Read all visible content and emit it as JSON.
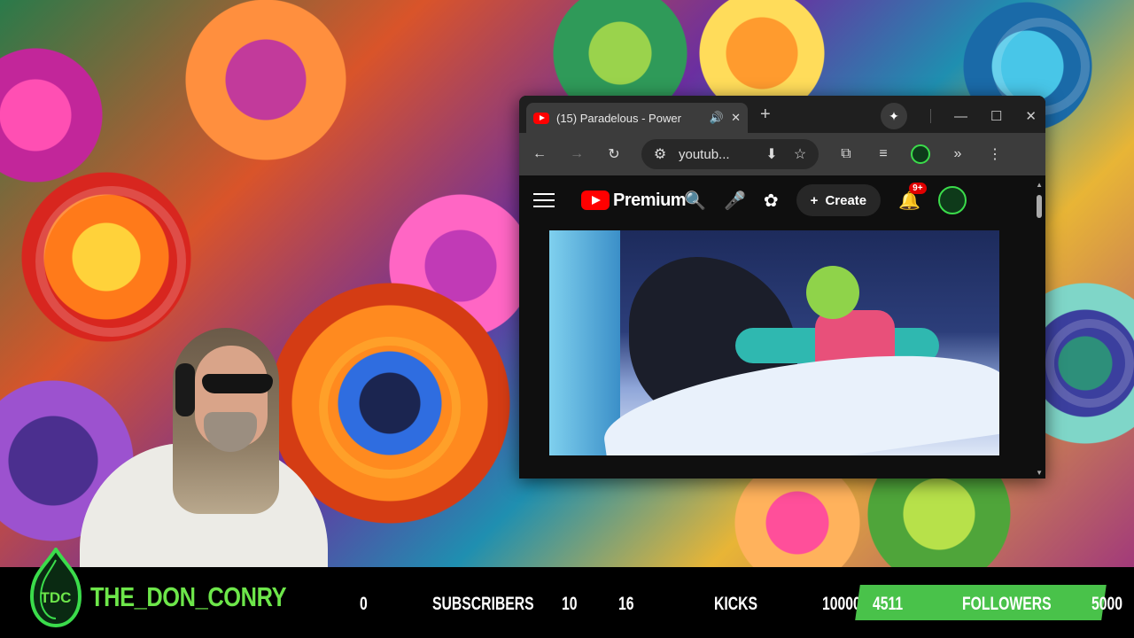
{
  "browser": {
    "tab": {
      "title": "(15) Paradelous - Power",
      "audio_icon": "🔊",
      "close_icon": "✕"
    },
    "new_tab_icon": "+",
    "window_controls": {
      "gemini_icon": "✦",
      "minimize_icon": "—",
      "maximize_icon": "☐",
      "close_icon": "✕"
    },
    "toolbar": {
      "back_icon": "←",
      "forward_icon": "→",
      "reload_icon": "↻",
      "site_info_icon": "⚙",
      "url_text": "youtub...",
      "install_icon": "⬇",
      "bookmark_icon": "☆",
      "extensions_icon": "⧉",
      "reading_list_icon": "≡",
      "more_tools_icon": "»",
      "menu_icon": "⋮"
    }
  },
  "youtube": {
    "logo_text": "Premium",
    "search_icon": "🔍",
    "mic_icon": "🎤",
    "create_icon": "+",
    "create_label": "Create",
    "bell_icon": "🔔",
    "notification_count": "9+",
    "accent_color": "#ff0000"
  },
  "stream_overlay": {
    "logo_text": "TDC",
    "channel_name": "THE_DON_CONRY",
    "subscribers_current": "0",
    "subscribers_label": "SUBSCRIBERS",
    "subscribers_goal": "10",
    "kicks_current": "16",
    "kicks_label": "KICKS",
    "kicks_goal": "10000",
    "followers_current": "4511",
    "followers_label": "FOLLOWERS",
    "followers_goal": "5000",
    "followers_progress_fraction": 0.902,
    "brand_green": "#6de64a"
  }
}
